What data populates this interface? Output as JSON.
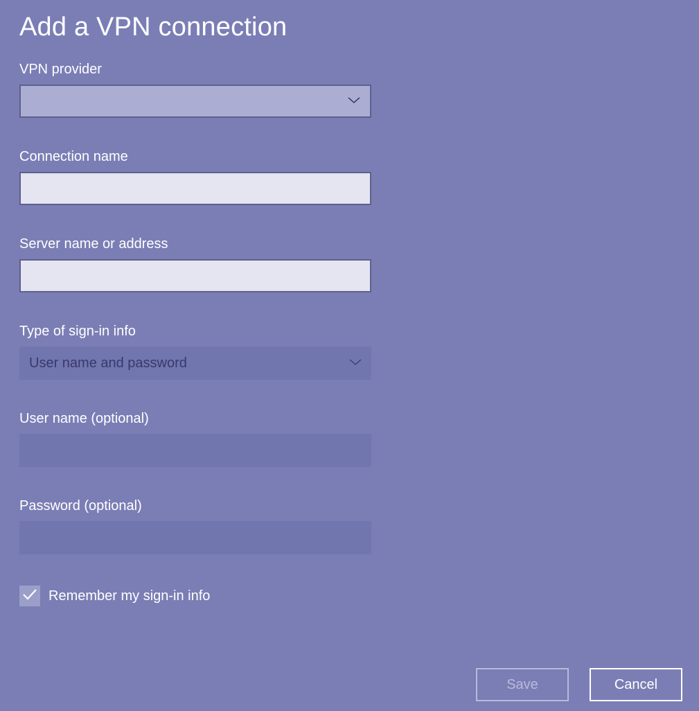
{
  "title": "Add a VPN connection",
  "fields": {
    "vpn_provider": {
      "label": "VPN provider",
      "value": ""
    },
    "connection_name": {
      "label": "Connection name",
      "value": ""
    },
    "server": {
      "label": "Server name or address",
      "value": ""
    },
    "signin_type": {
      "label": "Type of sign-in info",
      "value": "User name and password"
    },
    "username": {
      "label": "User name (optional)",
      "value": ""
    },
    "password": {
      "label": "Password (optional)",
      "value": ""
    }
  },
  "remember": {
    "label": "Remember my sign-in info",
    "checked": true
  },
  "buttons": {
    "save": "Save",
    "cancel": "Cancel"
  }
}
